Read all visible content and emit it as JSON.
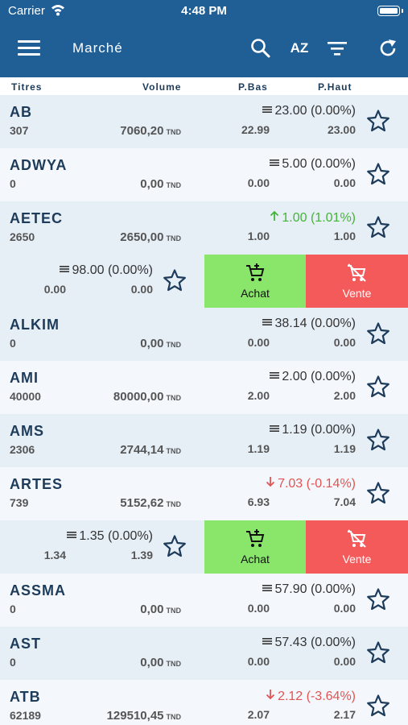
{
  "status_bar": {
    "carrier": "Carrier",
    "time": "4:48 PM"
  },
  "nav": {
    "title": "Marché",
    "sort_label": "AZ"
  },
  "columns": {
    "titres": "Titres",
    "volume": "Volume",
    "pbas": "P.Bas",
    "phaut": "P.Haut"
  },
  "currency": "TND",
  "actions": {
    "buy": "Achat",
    "sell": "Vente"
  },
  "colors": {
    "header": "#1f5f96",
    "up": "#44b437",
    "down": "#e25454",
    "buy": "#89e66a",
    "sell": "#f45a5a"
  },
  "rows": [
    {
      "symbol": "AB",
      "quantity": "307",
      "volume": "7060,20",
      "trend_icon": "equal",
      "price": "23.00 (0.00%)",
      "low": "22.99",
      "high": "23.00"
    },
    {
      "symbol": "ADWYA",
      "quantity": "0",
      "volume": "0,00",
      "trend_icon": "equal",
      "price": "5.00 (0.00%)",
      "low": "0.00",
      "high": "0.00"
    },
    {
      "symbol": "AETEC",
      "quantity": "2650",
      "volume": "2650,00",
      "trend_icon": "up",
      "price": "1.00 (1.01%)",
      "low": "1.00",
      "high": "1.00"
    },
    {
      "swiped": true,
      "trend_icon": "equal",
      "price": "98.00 (0.00%)",
      "low": "0.00",
      "high": "0.00"
    },
    {
      "symbol": "ALKIM",
      "quantity": "0",
      "volume": "0,00",
      "trend_icon": "equal",
      "price": "38.14 (0.00%)",
      "low": "0.00",
      "high": "0.00"
    },
    {
      "symbol": "AMI",
      "quantity": "40000",
      "volume": "80000,00",
      "trend_icon": "equal",
      "price": "2.00 (0.00%)",
      "low": "2.00",
      "high": "2.00"
    },
    {
      "symbol": "AMS",
      "quantity": "2306",
      "volume": "2744,14",
      "trend_icon": "equal",
      "price": "1.19 (0.00%)",
      "low": "1.19",
      "high": "1.19"
    },
    {
      "symbol": "ARTES",
      "quantity": "739",
      "volume": "5152,62",
      "trend_icon": "down",
      "price": "7.03 (-0.14%)",
      "low": "6.93",
      "high": "7.04"
    },
    {
      "swiped": true,
      "trend_icon": "equal",
      "price": "1.35 (0.00%)",
      "low": "1.34",
      "high": "1.39"
    },
    {
      "symbol": "ASSMA",
      "quantity": "0",
      "volume": "0,00",
      "trend_icon": "equal",
      "price": "57.90 (0.00%)",
      "low": "0.00",
      "high": "0.00"
    },
    {
      "symbol": "AST",
      "quantity": "0",
      "volume": "0,00",
      "trend_icon": "equal",
      "price": "57.43 (0.00%)",
      "low": "0.00",
      "high": "0.00"
    },
    {
      "symbol": "ATB",
      "quantity": "62189",
      "volume": "129510,45",
      "trend_icon": "down",
      "price": "2.12 (-3.64%)",
      "low": "2.07",
      "high": "2.17"
    }
  ]
}
